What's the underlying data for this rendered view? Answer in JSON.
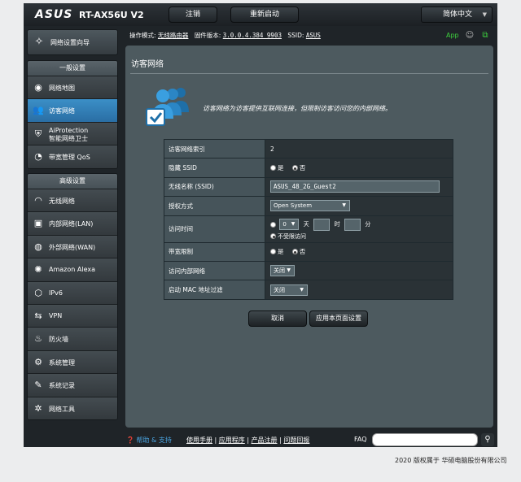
{
  "header": {
    "logo": "ASUS",
    "model": "RT-AX56U V2",
    "logout_label": "注销",
    "reboot_label": "重新启动",
    "language": "简体中文"
  },
  "qis": {
    "label": "网络设置向导",
    "icon": "wand-icon"
  },
  "general": {
    "title": "一般设置",
    "items": [
      {
        "label": "网络地图",
        "icon": "network-map-icon",
        "active": false
      },
      {
        "label": "访客网络",
        "icon": "guest-network-icon",
        "active": true
      },
      {
        "label": "AiProtection",
        "label2": "智能网络卫士",
        "icon": "shield-icon",
        "active": false
      },
      {
        "label": "带宽管理 QoS",
        "icon": "qos-gauge-icon",
        "active": false
      }
    ]
  },
  "advanced": {
    "title": "高级设置",
    "items": [
      {
        "label": "无线网络",
        "icon": "wifi-icon"
      },
      {
        "label": "内部网络(LAN)",
        "icon": "lan-icon"
      },
      {
        "label": "外部网络(WAN)",
        "icon": "globe-icon"
      },
      {
        "label": "Amazon Alexa",
        "icon": "alexa-icon"
      },
      {
        "label": "IPv6",
        "icon": "ipv6-icon"
      },
      {
        "label": "VPN",
        "icon": "vpn-icon"
      },
      {
        "label": "防火墙",
        "icon": "firewall-icon"
      },
      {
        "label": "系统管理",
        "icon": "admin-icon"
      },
      {
        "label": "系统记录",
        "icon": "log-icon"
      },
      {
        "label": "网络工具",
        "icon": "tools-icon"
      }
    ]
  },
  "status": {
    "mode_label": "操作模式:",
    "mode_value": "无线路由器",
    "firmware_label": "固件版本:",
    "firmware_value": "3.0.0.4.384_9903",
    "ssid_label": "SSID:",
    "ssid_value": "ASUS",
    "app_label": "App"
  },
  "content": {
    "title": "访客网络",
    "description": "访客网络为访客提供互联网连接，但限制访客访问您的内部网络。",
    "rows": {
      "index": {
        "label": "访客网络索引",
        "value": "2"
      },
      "hide_ssid": {
        "label": "隐藏 SSID",
        "opt_yes": "是",
        "opt_no": "否",
        "selected": "否"
      },
      "ssid": {
        "label": "无线名称 (SSID)",
        "value": "ASUS_48_2G_Guest2"
      },
      "auth": {
        "label": "授权方式",
        "value": "Open System"
      },
      "access_time": {
        "label": "访问时间",
        "days": "0",
        "day_unit": "天",
        "hour_unit": "时",
        "minute_unit": "分",
        "unlimited": "不受限访问",
        "unlimited_checked": true
      },
      "bandwidth": {
        "label": "带宽限制",
        "opt_yes": "是",
        "opt_no": "否",
        "selected": "否"
      },
      "intranet": {
        "label": "访问内部网络",
        "value": "关闭"
      },
      "mac_filter": {
        "label": "启动 MAC 地址过滤",
        "value": "关闭"
      }
    },
    "cancel_label": "取消",
    "apply_label": "应用本页面设置"
  },
  "footer": {
    "help": "帮助 & 支持",
    "links": [
      "使用手册",
      "应用程序",
      "产品注册",
      "问题回报"
    ],
    "faq": "FAQ",
    "copyright": "2020 版权属于 华硕电脑股份有限公司"
  },
  "colors": {
    "accent": "#3b8fc7",
    "app_green": "#3ed13e",
    "panel": "#4d5a5f"
  }
}
